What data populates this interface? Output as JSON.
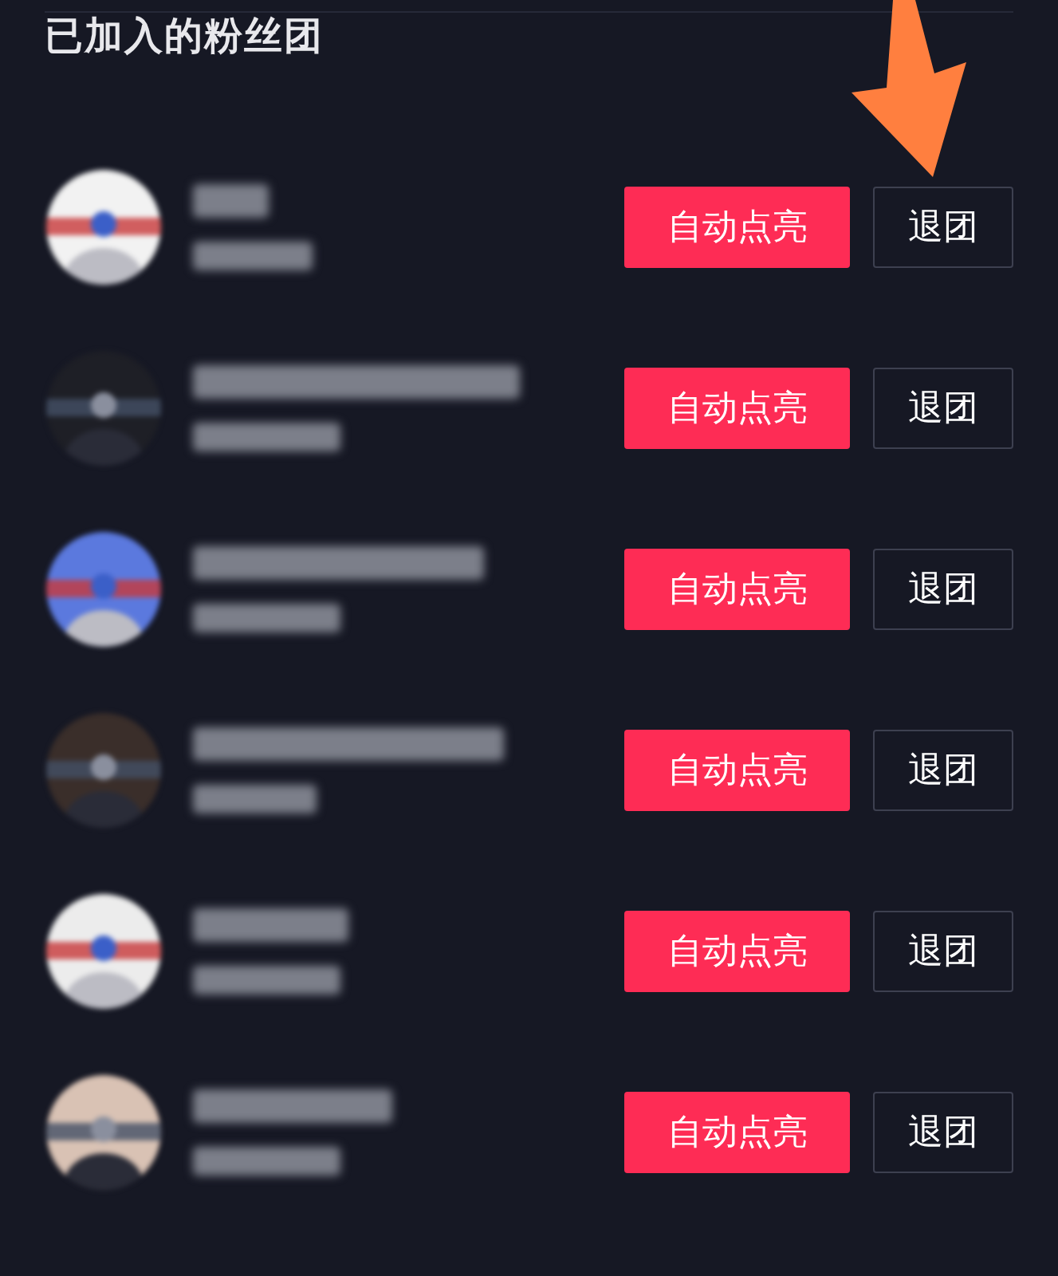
{
  "title": "已加入的粉丝团",
  "rows": [
    {
      "auto_button": "自动点亮",
      "leave_button": "退团"
    },
    {
      "auto_button": "自动点亮",
      "leave_button": "退团"
    },
    {
      "auto_button": "自动点亮",
      "leave_button": "退团"
    },
    {
      "auto_button": "自动点亮",
      "leave_button": "退团"
    },
    {
      "auto_button": "自动点亮",
      "leave_button": "退团"
    },
    {
      "auto_button": "自动点亮",
      "leave_button": "退团"
    }
  ]
}
